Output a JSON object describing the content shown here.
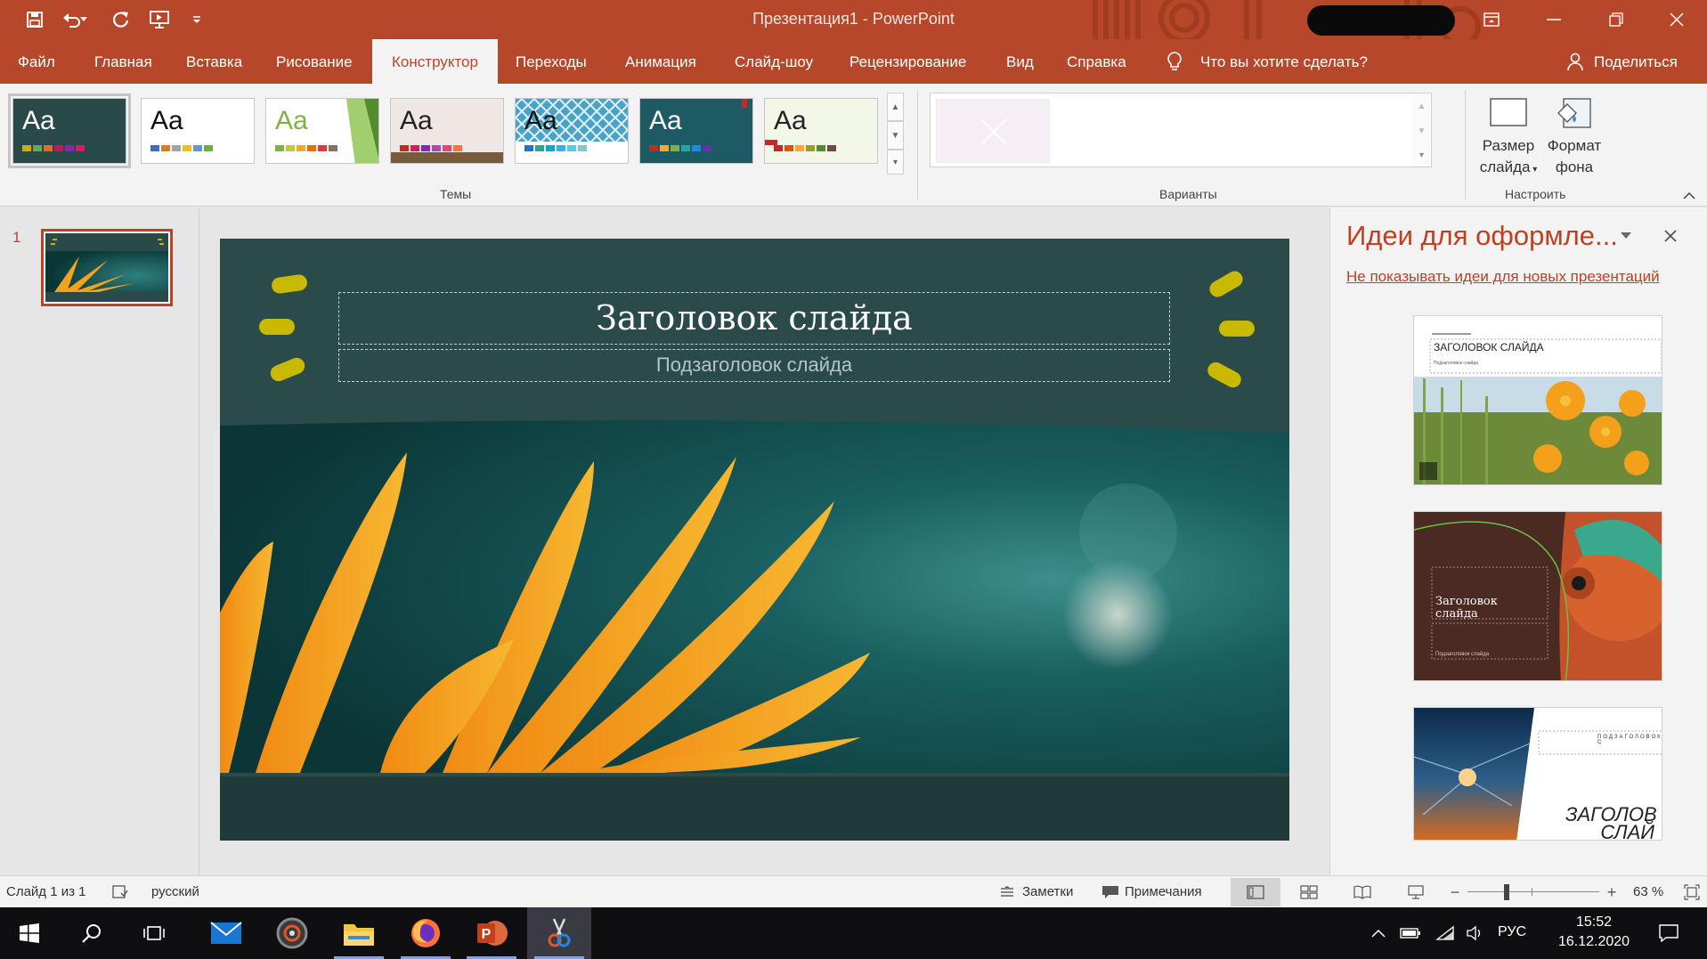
{
  "window": {
    "title": "Презентация1  -  PowerPoint",
    "quick_access": [
      "save-icon",
      "undo-icon",
      "redo-icon",
      "present-from-start-icon",
      "customize-qat-icon"
    ],
    "controls": [
      "ribbon-display-options-icon",
      "minimize-icon",
      "restore-icon",
      "close-icon"
    ]
  },
  "tabs": [
    {
      "label": "Файл"
    },
    {
      "label": "Главная"
    },
    {
      "label": "Вставка"
    },
    {
      "label": "Рисование"
    },
    {
      "label": "Конструктор"
    },
    {
      "label": "Переходы"
    },
    {
      "label": "Анимация"
    },
    {
      "label": "Слайд-шоу"
    },
    {
      "label": "Рецензирование"
    },
    {
      "label": "Вид"
    },
    {
      "label": "Справка"
    }
  ],
  "active_tab": "Конструктор",
  "tell_me": "Что вы хотите сделать?",
  "share": "Поделиться",
  "ribbon": {
    "themes_label": "Темы",
    "variants_label": "Варианты",
    "customize_label": "Настроить",
    "themes": [
      {
        "aa": "Aa",
        "bg": "#2a4a4a",
        "fg": "#ffffff",
        "colors": [
          "#c8b400",
          "#6aa84f",
          "#e06c1c",
          "#c2185b",
          "#8e24aa",
          "#d81b60"
        ]
      },
      {
        "aa": "Aa",
        "bg": "#ffffff",
        "fg": "#111111",
        "colors": [
          "#3b6fb6",
          "#e07b24",
          "#a5a5a5",
          "#f4c20d",
          "#5b9bd5",
          "#70ad47"
        ]
      },
      {
        "aa": "Aa",
        "bg": "#ffffff",
        "fg": "#7cb342",
        "colors": [
          "#7cb342",
          "#c0ca33",
          "#f9a825",
          "#ef6c00",
          "#e53935",
          "#8d6e63"
        ]
      },
      {
        "aa": "Aa",
        "bg": "#efe7e4",
        "fg": "#222222",
        "colors": [
          "#c62828",
          "#d81b60",
          "#8e24aa",
          "#ab47bc",
          "#ec407a",
          "#ff7043"
        ]
      },
      {
        "aa": "Aa",
        "bg": "#4aa3c6",
        "fg": "#111111",
        "colors": [
          "#1976d2",
          "#26a69a",
          "#00acc1",
          "#29b6f6",
          "#4dd0e1",
          "#80cbc4"
        ]
      },
      {
        "aa": "Aa",
        "bg": "#1d5a63",
        "fg": "#ffffff",
        "colors": [
          "#c62828",
          "#f9a825",
          "#7cb342",
          "#26a69a",
          "#1e88e5",
          "#5e35b1"
        ]
      },
      {
        "aa": "Aa",
        "bg": "#f3f7e8",
        "fg": "#222222",
        "colors": [
          "#c62828",
          "#e65100",
          "#f9a825",
          "#9e9d24",
          "#558b2f",
          "#6d4c41"
        ]
      }
    ],
    "slide_size": [
      "Размер",
      "слайда"
    ],
    "format_bg": [
      "Формат",
      "фона"
    ]
  },
  "thumbnails": [
    {
      "number": "1"
    }
  ],
  "slide": {
    "title": "Заголовок слайда",
    "subtitle": "Подзаголовок слайда"
  },
  "design_pane": {
    "title": "Идеи для оформле...",
    "link": "Не показывать идеи для новых презентаций",
    "ideas": [
      {
        "title": "ЗАГОЛОВОК СЛАЙДА",
        "subtitle": "Подзаголовок слайда"
      },
      {
        "title": "Заголовок слайда",
        "subtitle": "Подзаголовок слайда"
      },
      {
        "title": "ЗАГОЛОВ СЛАЙ",
        "subtitle": "ПОДЗАГОЛОВОК С"
      }
    ]
  },
  "status": {
    "slide_info": "Слайд 1 из 1",
    "language": "русский",
    "notes": "Заметки",
    "comments": "Примечания",
    "zoom": "63 %",
    "zoom_value": 63
  },
  "taskbar": {
    "lang": "РУС",
    "time": "15:52",
    "date": "16.12.2020",
    "apps": [
      "mail-icon",
      "media-player-icon",
      "file-explorer-icon",
      "firefox-icon",
      "powerpoint-icon",
      "snipping-tool-icon"
    ]
  }
}
